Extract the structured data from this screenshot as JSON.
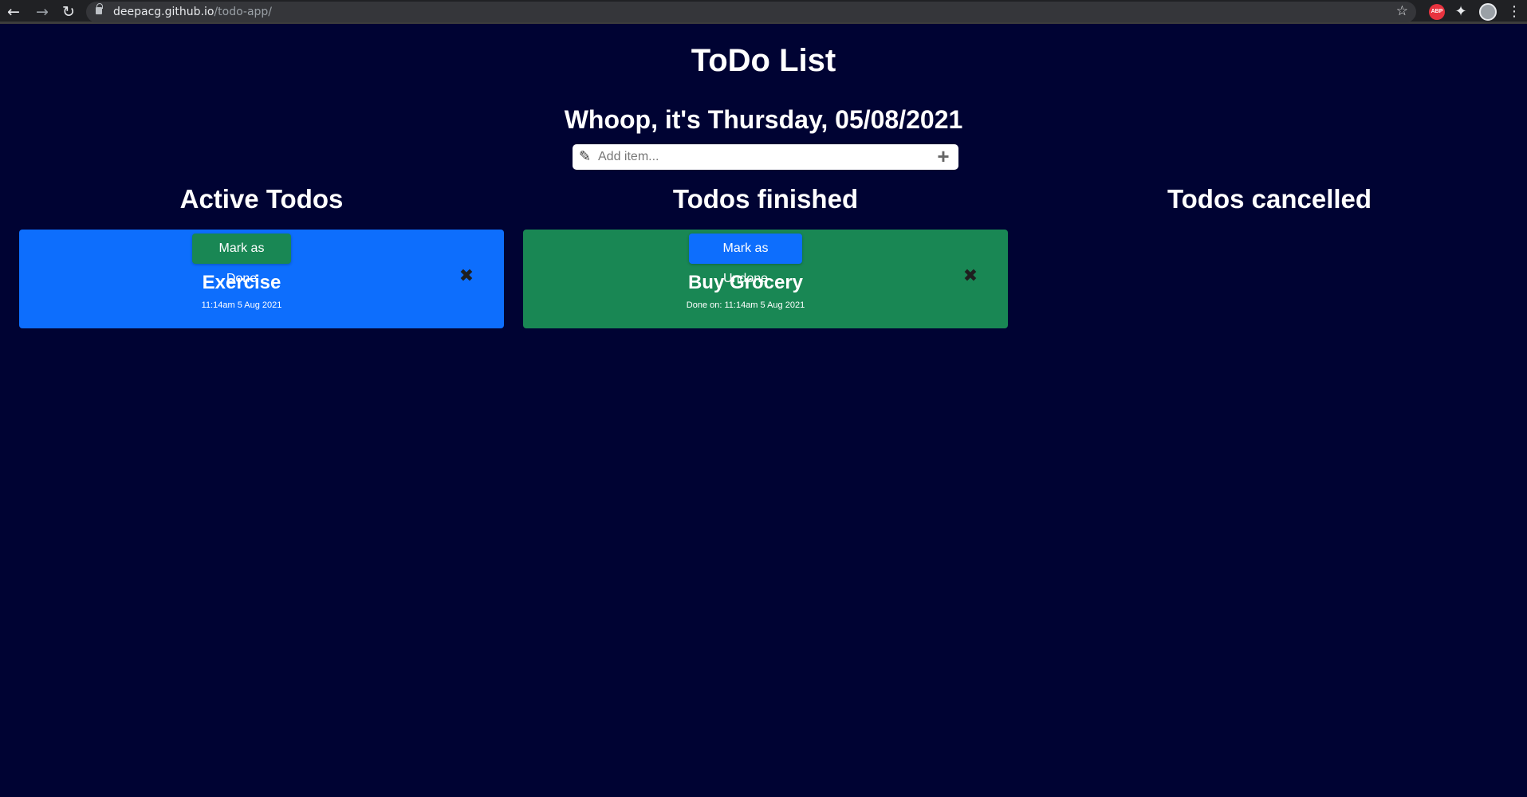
{
  "browser": {
    "url_host": "deepacg.github.io",
    "url_path": "/todo-app/",
    "icons": [
      "back-arrow-icon",
      "forward-arrow-icon",
      "reload-icon",
      "lock-icon",
      "star-icon",
      "adblock-icon",
      "extensions-icon",
      "profile-icon",
      "menu-icon"
    ],
    "adblock_label": "ABP"
  },
  "page": {
    "title": "ToDo List",
    "greeting": "Whoop, it's Thursday, 05/08/2021",
    "add_placeholder": "Add item...",
    "background_color": "#000333"
  },
  "columns": {
    "active": {
      "heading": "Active Todos",
      "items": [
        {
          "title": "Exercise",
          "meta": "11:14am 5 Aug 2021",
          "action_label": "Mark as Done",
          "card_color": "#0d6efd"
        }
      ]
    },
    "finished": {
      "heading": "Todos finished",
      "items": [
        {
          "title": "Buy Grocery",
          "meta": "Done on: 11:14am 5 Aug 2021",
          "action_label": "Mark as Undone",
          "card_color": "#198754"
        }
      ]
    },
    "cancelled": {
      "heading": "Todos cancelled",
      "items": []
    }
  }
}
